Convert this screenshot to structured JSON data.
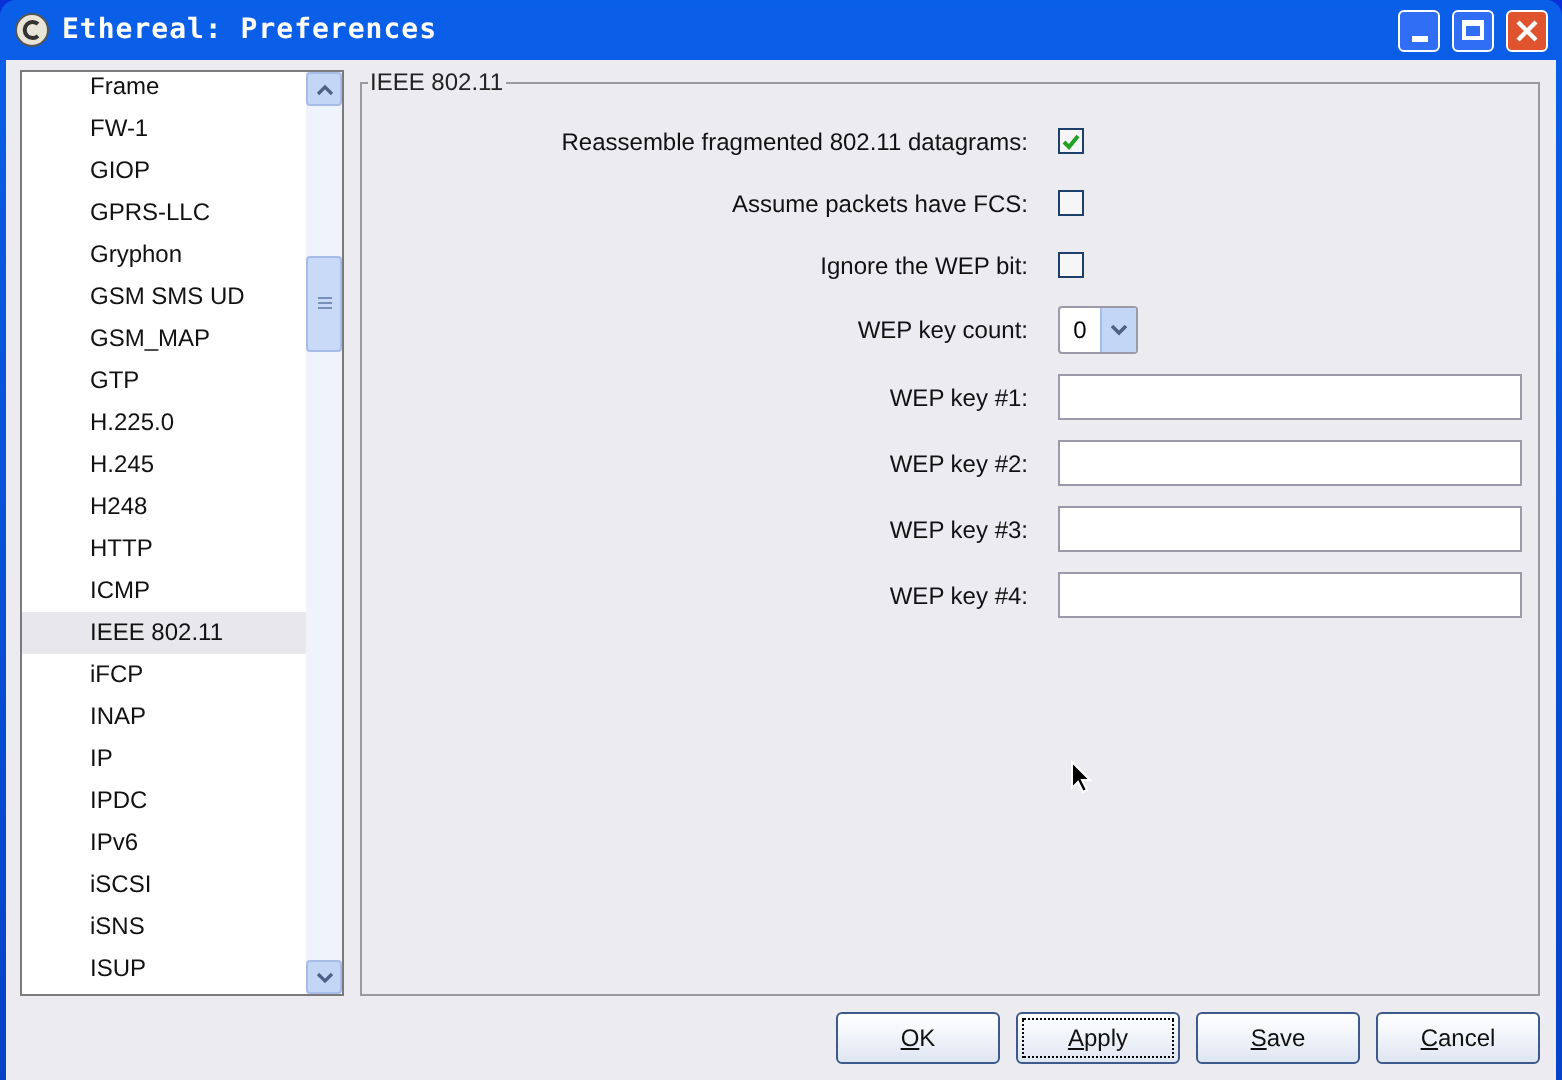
{
  "window": {
    "title": "Ethereal: Preferences"
  },
  "sidebar": {
    "items": [
      {
        "label": "Frame",
        "selected": false
      },
      {
        "label": "FW-1",
        "selected": false
      },
      {
        "label": "GIOP",
        "selected": false
      },
      {
        "label": "GPRS-LLC",
        "selected": false
      },
      {
        "label": "Gryphon",
        "selected": false
      },
      {
        "label": "GSM SMS UD",
        "selected": false
      },
      {
        "label": "GSM_MAP",
        "selected": false
      },
      {
        "label": "GTP",
        "selected": false
      },
      {
        "label": "H.225.0",
        "selected": false
      },
      {
        "label": "H.245",
        "selected": false
      },
      {
        "label": "H248",
        "selected": false
      },
      {
        "label": "HTTP",
        "selected": false
      },
      {
        "label": "ICMP",
        "selected": false
      },
      {
        "label": "IEEE 802.11",
        "selected": true
      },
      {
        "label": "iFCP",
        "selected": false
      },
      {
        "label": "INAP",
        "selected": false
      },
      {
        "label": "IP",
        "selected": false
      },
      {
        "label": "IPDC",
        "selected": false
      },
      {
        "label": "IPv6",
        "selected": false
      },
      {
        "label": "iSCSI",
        "selected": false
      },
      {
        "label": "iSNS",
        "selected": false
      },
      {
        "label": "ISUP",
        "selected": false
      }
    ]
  },
  "panel": {
    "title": "IEEE 802.11",
    "rows": [
      {
        "kind": "checkbox",
        "label": "Reassemble fragmented 802.11 datagrams:",
        "checked": true
      },
      {
        "kind": "checkbox",
        "label": "Assume packets have FCS:",
        "checked": false
      },
      {
        "kind": "checkbox",
        "label": "Ignore the WEP bit:",
        "checked": false
      },
      {
        "kind": "dropdown",
        "label": "WEP key count:",
        "value": "0"
      },
      {
        "kind": "text",
        "label": "WEP key #1:"
      },
      {
        "kind": "text",
        "label": "WEP key #2:"
      },
      {
        "kind": "text",
        "label": "WEP key #3:"
      },
      {
        "kind": "text",
        "label": "WEP key #4:"
      }
    ]
  },
  "buttons": [
    {
      "label": "OK",
      "focused": false,
      "mnemonic_underlined": true
    },
    {
      "label": "Apply",
      "focused": true,
      "mnemonic_underlined": true
    },
    {
      "label": "Save",
      "focused": false,
      "mnemonic_underlined": true
    },
    {
      "label": "Cancel",
      "focused": false,
      "mnemonic_underlined": true
    }
  ]
}
